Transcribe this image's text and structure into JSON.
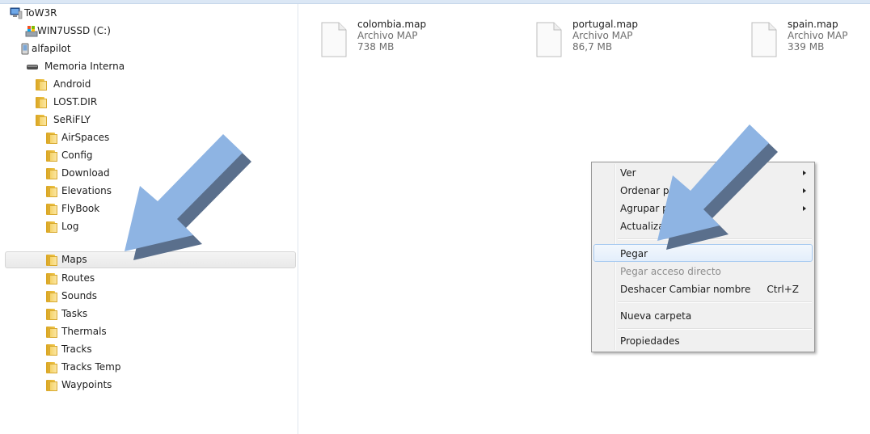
{
  "nav": {
    "items": [
      {
        "label": "ToW3R",
        "icon": "computer-icon"
      },
      {
        "label": "WIN7USSD (C:)",
        "icon": "drive-icon"
      },
      {
        "label": "alfapilot",
        "icon": "device-icon"
      },
      {
        "label": "Memoria Interna",
        "icon": "storage-icon"
      },
      {
        "label": "Android",
        "icon": "folder-icon"
      },
      {
        "label": "LOST.DIR",
        "icon": "folder-icon"
      },
      {
        "label": "SeRiFLY",
        "icon": "folder-icon"
      },
      {
        "label": "AirSpaces",
        "icon": "folder-icon"
      },
      {
        "label": "Config",
        "icon": "folder-icon"
      },
      {
        "label": "Download",
        "icon": "folder-icon"
      },
      {
        "label": "Elevations",
        "icon": "folder-icon"
      },
      {
        "label": "FlyBook",
        "icon": "folder-icon"
      },
      {
        "label": "Log",
        "icon": "folder-icon"
      },
      {
        "label": "Maps",
        "icon": "folder-icon"
      },
      {
        "label": "Routes",
        "icon": "folder-icon"
      },
      {
        "label": "Sounds",
        "icon": "folder-icon"
      },
      {
        "label": "Tasks",
        "icon": "folder-icon"
      },
      {
        "label": "Thermals",
        "icon": "folder-icon"
      },
      {
        "label": "Tracks",
        "icon": "folder-icon"
      },
      {
        "label": "Tracks Temp",
        "icon": "folder-icon"
      },
      {
        "label": "Waypoints",
        "icon": "folder-icon"
      }
    ],
    "selected": "Maps"
  },
  "files": [
    {
      "name": "colombia.map",
      "type": "Archivo MAP",
      "size": "738 MB"
    },
    {
      "name": "portugal.map",
      "type": "Archivo MAP",
      "size": "86,7 MB"
    },
    {
      "name": "spain.map",
      "type": "Archivo MAP",
      "size": "339 MB"
    }
  ],
  "context_menu": {
    "ver": "Ver",
    "ordenar": "Ordenar por",
    "agrupar": "Agrupar por",
    "actualizar": "Actualizar",
    "pegar": "Pegar",
    "pegar_acceso": "Pegar acceso directo",
    "deshacer": "Deshacer Cambiar nombre",
    "deshacer_shortcut": "Ctrl+Z",
    "nueva_carpeta": "Nueva carpeta",
    "propiedades": "Propiedades"
  },
  "colors": {
    "arrow": "#8eb4e3",
    "arrow_shadow": "#5a6f8c",
    "folder": "#f3cf5c",
    "menu_bg": "#f0f0f0"
  }
}
